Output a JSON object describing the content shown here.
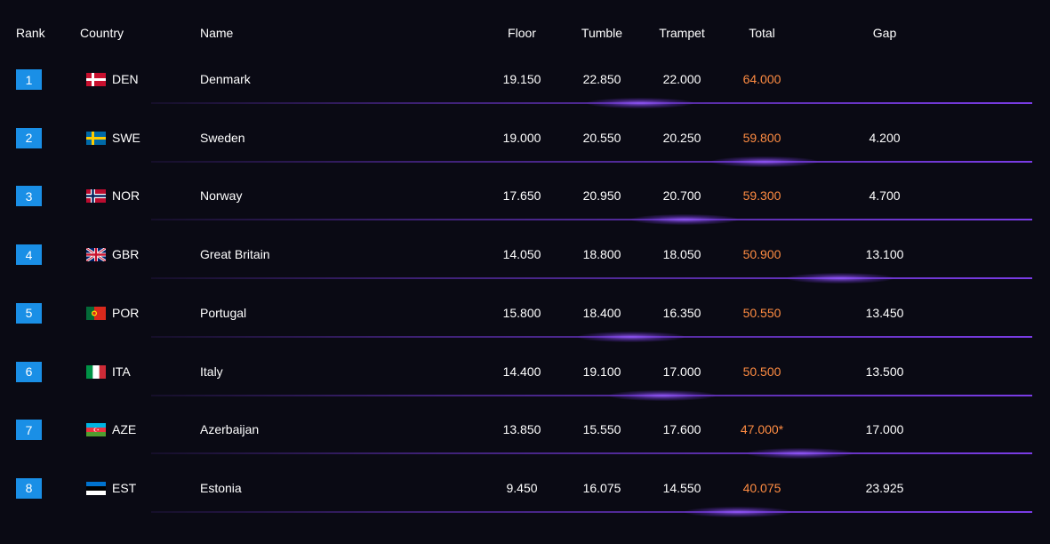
{
  "header": {
    "rank": "Rank",
    "country": "Country",
    "name": "Name",
    "floor": "Floor",
    "tumble": "Tumble",
    "trampet": "Trampet",
    "total": "Total",
    "gap": "Gap"
  },
  "colors": {
    "background": "#0a0a14",
    "rank_badge": "#1a8fe6",
    "total_text": "#ff8c42",
    "separator": "#7a3ce6"
  },
  "rows": [
    {
      "rank": "1",
      "code": "DEN",
      "name": "Denmark",
      "floor": "19.150",
      "tumble": "22.850",
      "trampet": "22.000",
      "total": "64.000",
      "gap": "",
      "flag_icon": "denmark-flag-icon"
    },
    {
      "rank": "2",
      "code": "SWE",
      "name": "Sweden",
      "floor": "19.000",
      "tumble": "20.550",
      "trampet": "20.250",
      "total": "59.800",
      "gap": "4.200",
      "flag_icon": "sweden-flag-icon"
    },
    {
      "rank": "3",
      "code": "NOR",
      "name": "Norway",
      "floor": "17.650",
      "tumble": "20.950",
      "trampet": "20.700",
      "total": "59.300",
      "gap": "4.700",
      "flag_icon": "norway-flag-icon"
    },
    {
      "rank": "4",
      "code": "GBR",
      "name": "Great Britain",
      "floor": "14.050",
      "tumble": "18.800",
      "trampet": "18.050",
      "total": "50.900",
      "gap": "13.100",
      "flag_icon": "great-britain-flag-icon"
    },
    {
      "rank": "5",
      "code": "POR",
      "name": "Portugal",
      "floor": "15.800",
      "tumble": "18.400",
      "trampet": "16.350",
      "total": "50.550",
      "gap": "13.450",
      "flag_icon": "portugal-flag-icon"
    },
    {
      "rank": "6",
      "code": "ITA",
      "name": "Italy",
      "floor": "14.400",
      "tumble": "19.100",
      "trampet": "17.000",
      "total": "50.500",
      "gap": "13.500",
      "flag_icon": "italy-flag-icon"
    },
    {
      "rank": "7",
      "code": "AZE",
      "name": "Azerbaijan",
      "floor": "13.850",
      "tumble": "15.550",
      "trampet": "17.600",
      "total": "47.000*",
      "gap": "17.000",
      "flag_icon": "azerbaijan-flag-icon"
    },
    {
      "rank": "8",
      "code": "EST",
      "name": "Estonia",
      "floor": "9.450",
      "tumble": "16.075",
      "trampet": "14.550",
      "total": "40.075",
      "gap": "23.925",
      "flag_icon": "estonia-flag-icon"
    }
  ]
}
